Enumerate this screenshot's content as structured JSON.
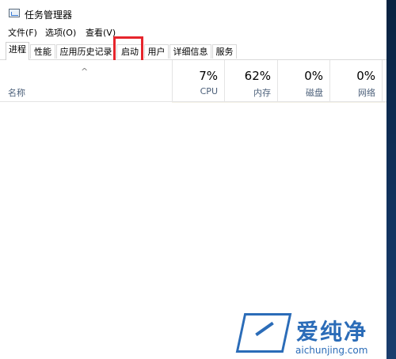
{
  "window": {
    "title": "任务管理器"
  },
  "menu": [
    "文件(F)",
    "选项(O)",
    "查看(V)"
  ],
  "tabs": [
    "进程",
    "性能",
    "应用历史记录",
    "启动",
    "用户",
    "详细信息",
    "服务"
  ],
  "active_tab": "进程",
  "highlighted_tab": "启动",
  "highlight_color": "#e6252c",
  "table": {
    "name_header": "名称",
    "sort_indicator": "^",
    "columns": [
      {
        "percent": "7%",
        "label": "CPU"
      },
      {
        "percent": "62%",
        "label": "内存"
      },
      {
        "percent": "0%",
        "label": "磁盘"
      },
      {
        "percent": "0%",
        "label": "网络"
      }
    ]
  },
  "watermark": {
    "brand": "爱纯净",
    "url": "aichunjing.com"
  }
}
